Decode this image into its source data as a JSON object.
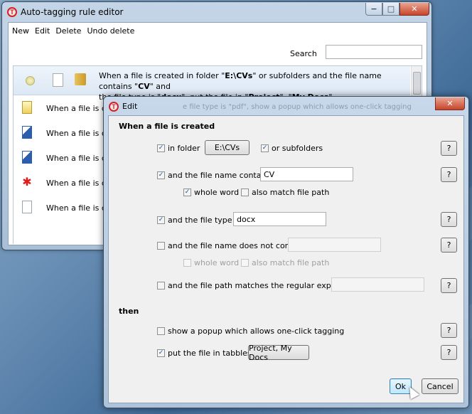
{
  "main_window": {
    "title": "Auto-tagging rule editor",
    "caption_buttons": {
      "minimize": "−",
      "maximize": "□",
      "close": "✕"
    },
    "menu": [
      "New",
      "Edit",
      "Delete",
      "Undo delete"
    ],
    "search_label": "Search",
    "search_value": "",
    "selected_rule": {
      "line1_pre": "When a file is created in folder \"",
      "folder": "E:\\CVs",
      "line1_mid": "\" or subfolders and the file name contains \"",
      "name": "CV",
      "line1_post": "\" and",
      "line2_pre": "the file type is \"",
      "type": "docx",
      "line2_mid": "\", put the file in  \"",
      "tag1": "Project",
      "line2_sep": "\", \"",
      "tag2": "My Docs",
      "line2_post": "\"."
    },
    "rules": [
      {
        "label": "When a file is creat",
        "icon": "pdf-file-icon"
      },
      {
        "label": "When a file is creat",
        "icon": "word-doc-icon"
      },
      {
        "label": "When a file is creat",
        "icon": "word-doc-icon"
      },
      {
        "label": "When a file is creat",
        "icon": "red-star-file-icon"
      },
      {
        "label": "When a file is creat",
        "icon": "blank-file-icon"
      }
    ]
  },
  "edit_dialog": {
    "title": "Edit",
    "behind_text": "e file type is \"pdf\", show a popup which allows one-click tagging",
    "section_when": "When a file is created",
    "in_folder": {
      "label": "in folder",
      "checked": "✓",
      "button": "E:\\CVs"
    },
    "subfolders": {
      "label": "or subfolders",
      "checked": "✓"
    },
    "name_contains": {
      "label": "and the file name contains",
      "checked": "✓",
      "value": "CV"
    },
    "whole_word": {
      "label": "whole word",
      "checked": "✓"
    },
    "match_path": {
      "label": "also match file path",
      "checked": ""
    },
    "file_type": {
      "label": "and the file type is",
      "checked": "✓",
      "value": "docx"
    },
    "not_contain": {
      "label": "and the file name does not contain",
      "checked": "",
      "value": ""
    },
    "whole_word2": {
      "label": "whole word",
      "checked": ""
    },
    "match_path2": {
      "label": "also match file path",
      "checked": ""
    },
    "regex": {
      "label": "and the file path matches the regular expression",
      "checked": "",
      "value": ""
    },
    "section_then": "then",
    "popup": {
      "label": "show a popup which allows one-click tagging",
      "checked": ""
    },
    "put_file": {
      "label": "put the file in tabbles:",
      "checked": "✓",
      "button": "Project, My Docs"
    },
    "help_label": "?",
    "ok_label": "Ok",
    "cancel_label": "Cancel"
  }
}
